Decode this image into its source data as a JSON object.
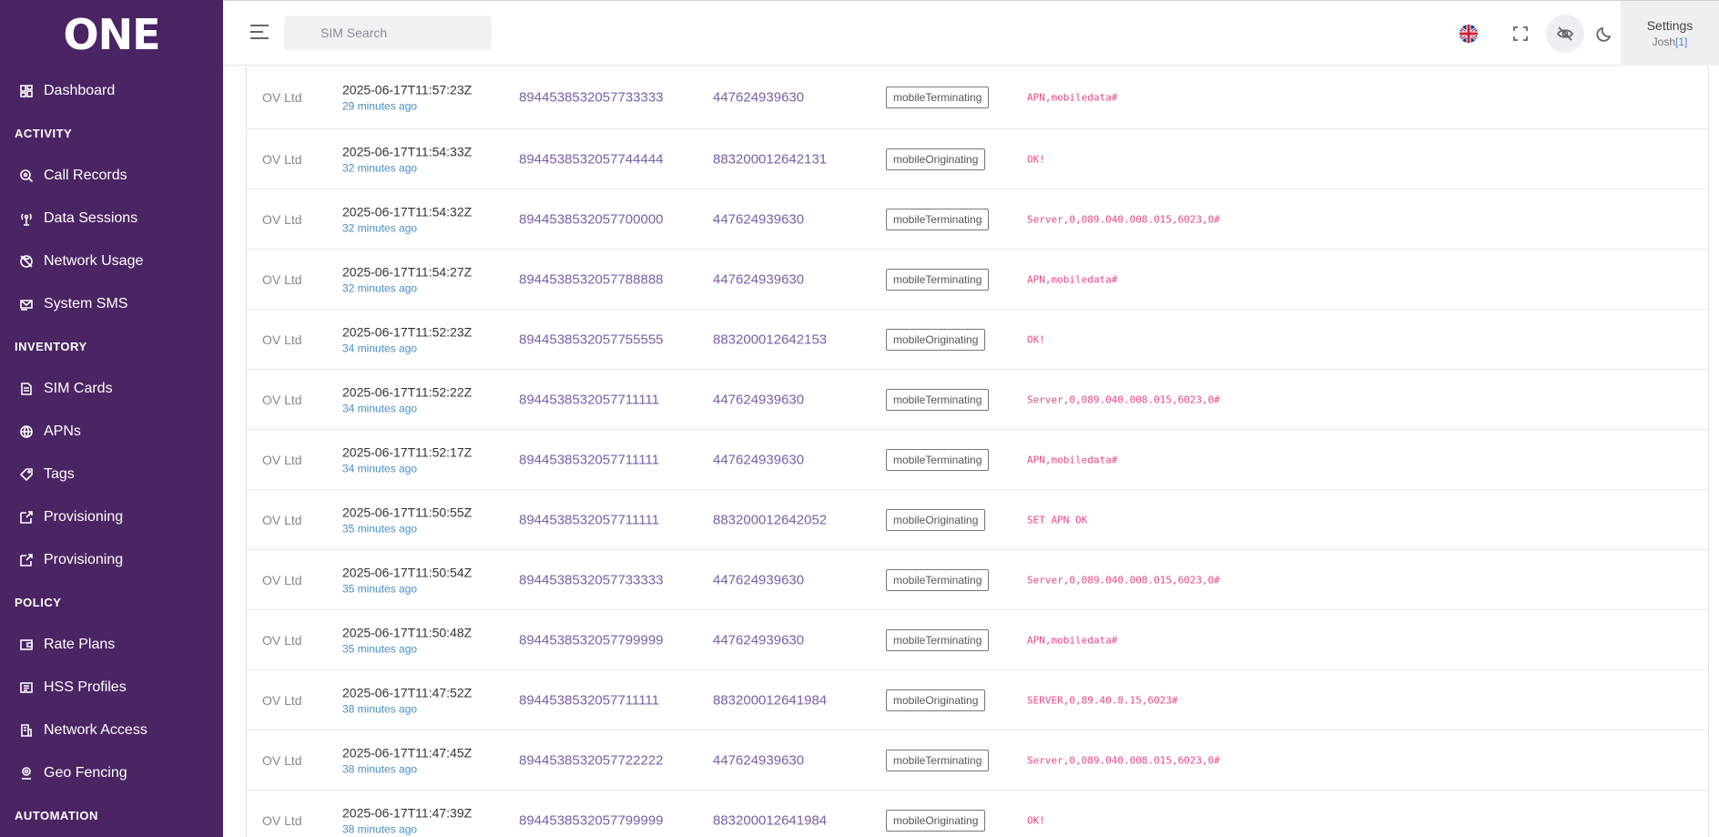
{
  "app": {
    "logo": "ONE"
  },
  "sidebar": {
    "top_item": {
      "label": "Dashboard",
      "icon": "dashboard-icon"
    },
    "sections": [
      {
        "title": "ACTIVITY",
        "items": [
          {
            "label": "Call Records",
            "icon": "search-circle-icon"
          },
          {
            "label": "Data Sessions",
            "icon": "antenna-icon"
          },
          {
            "label": "Network Usage",
            "icon": "globe-off-icon"
          },
          {
            "label": "System SMS",
            "icon": "message-icon"
          }
        ]
      },
      {
        "title": "INVENTORY",
        "items": [
          {
            "label": "SIM Cards",
            "icon": "document-icon"
          },
          {
            "label": "APNs",
            "icon": "globe-icon"
          },
          {
            "label": "Tags",
            "icon": "tag-icon"
          },
          {
            "label": "Provisioning",
            "icon": "provisioning-icon"
          },
          {
            "label": "Provisioning",
            "icon": "provisioning-icon"
          }
        ]
      },
      {
        "title": "POLICY",
        "items": [
          {
            "label": "Rate Plans",
            "icon": "wallet-icon"
          },
          {
            "label": "HSS Profiles",
            "icon": "profile-list-icon"
          },
          {
            "label": "Network Access",
            "icon": "building-icon"
          },
          {
            "label": "Geo Fencing",
            "icon": "location-icon"
          }
        ]
      },
      {
        "title": "AUTOMATION",
        "items": []
      }
    ]
  },
  "header": {
    "search_placeholder": "SIM Search",
    "settings_label": "Settings",
    "user_name": "Josh",
    "user_count": "[1]"
  },
  "colors": {
    "sidebar_bg": "#4a2463",
    "link": "#7b5ea8",
    "relative_time": "#4a8ec4",
    "message": "#e8488a"
  },
  "rows": [
    {
      "org": "OV Ltd",
      "timestamp": "2025-06-17T11:57:23Z",
      "ago": "29 minutes ago",
      "iccid": "8944538532057733333",
      "msisdn": "447624939630",
      "type": "mobileTerminating",
      "message": "APN,mobiledata#"
    },
    {
      "org": "OV Ltd",
      "timestamp": "2025-06-17T11:54:33Z",
      "ago": "32 minutes ago",
      "iccid": "8944538532057744444",
      "msisdn": "883200012642131",
      "type": "mobileOriginating",
      "message": "OK!"
    },
    {
      "org": "OV Ltd",
      "timestamp": "2025-06-17T11:54:32Z",
      "ago": "32 minutes ago",
      "iccid": "8944538532057700000",
      "msisdn": "447624939630",
      "type": "mobileTerminating",
      "message": "Server,0,089.040.008.015,6023,0#"
    },
    {
      "org": "OV Ltd",
      "timestamp": "2025-06-17T11:54:27Z",
      "ago": "32 minutes ago",
      "iccid": "8944538532057788888",
      "msisdn": "447624939630",
      "type": "mobileTerminating",
      "message": "APN,mobiledata#"
    },
    {
      "org": "OV Ltd",
      "timestamp": "2025-06-17T11:52:23Z",
      "ago": "34 minutes ago",
      "iccid": "8944538532057755555",
      "msisdn": "883200012642153",
      "type": "mobileOriginating",
      "message": "OK!"
    },
    {
      "org": "OV Ltd",
      "timestamp": "2025-06-17T11:52:22Z",
      "ago": "34 minutes ago",
      "iccid": "8944538532057711111",
      "msisdn": "447624939630",
      "type": "mobileTerminating",
      "message": "Server,0,089.040.008.015,6023,0#"
    },
    {
      "org": "OV Ltd",
      "timestamp": "2025-06-17T11:52:17Z",
      "ago": "34 minutes ago",
      "iccid": "8944538532057711111",
      "msisdn": "447624939630",
      "type": "mobileTerminating",
      "message": "APN,mobiledata#"
    },
    {
      "org": "OV Ltd",
      "timestamp": "2025-06-17T11:50:55Z",
      "ago": "35 minutes ago",
      "iccid": "8944538532057711111",
      "msisdn": "883200012642052",
      "type": "mobileOriginating",
      "message": "SET APN OK"
    },
    {
      "org": "OV Ltd",
      "timestamp": "2025-06-17T11:50:54Z",
      "ago": "35 minutes ago",
      "iccid": "8944538532057733333",
      "msisdn": "447624939630",
      "type": "mobileTerminating",
      "message": "Server,0,089.040.008.015,6023,0#"
    },
    {
      "org": "OV Ltd",
      "timestamp": "2025-06-17T11:50:48Z",
      "ago": "35 minutes ago",
      "iccid": "8944538532057799999",
      "msisdn": "447624939630",
      "type": "mobileTerminating",
      "message": "APN,mobiledata#"
    },
    {
      "org": "OV Ltd",
      "timestamp": "2025-06-17T11:47:52Z",
      "ago": "38 minutes ago",
      "iccid": "8944538532057711111",
      "msisdn": "883200012641984",
      "type": "mobileOriginating",
      "message": "SERVER,0,89.40.8.15,6023#"
    },
    {
      "org": "OV Ltd",
      "timestamp": "2025-06-17T11:47:45Z",
      "ago": "38 minutes ago",
      "iccid": "8944538532057722222",
      "msisdn": "447624939630",
      "type": "mobileTerminating",
      "message": "Server,0,089.040.008.015,6023,0#"
    },
    {
      "org": "OV Ltd",
      "timestamp": "2025-06-17T11:47:39Z",
      "ago": "38 minutes ago",
      "iccid": "8944538532057799999",
      "msisdn": "883200012641984",
      "type": "mobileOriginating",
      "message": "OK!"
    }
  ]
}
